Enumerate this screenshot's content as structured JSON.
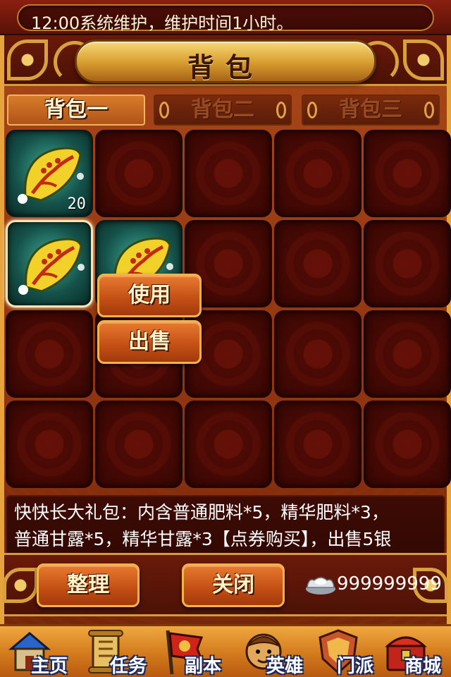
{
  "notice": {
    "text": "12:00系统维护，维护时间1小时。"
  },
  "panel": {
    "title": "背包"
  },
  "tabs": [
    {
      "label": "背包一",
      "active": true
    },
    {
      "label": "背包二",
      "active": false
    },
    {
      "label": "背包三",
      "active": false
    }
  ],
  "grid": {
    "rows": 4,
    "cols": 5,
    "items": [
      {
        "slot": 0,
        "icon": "gift-leaf-icon",
        "count": "20"
      },
      {
        "slot": 5,
        "icon": "gift-leaf-icon",
        "selected": true
      },
      {
        "slot": 6,
        "icon": "gift-leaf-icon"
      }
    ]
  },
  "context_menu": {
    "use_label": "使用",
    "sell_label": "出售"
  },
  "description": {
    "line1": "快快长大礼包：内含普通肥料*5，精华肥料*3，",
    "line2": "普通甘露*5，精华甘露*3【点券购买】，出售5银"
  },
  "actions": {
    "sort_label": "整理",
    "close_label": "关闭"
  },
  "currency": {
    "icon": "silver-ingot-icon",
    "amount": "999999999"
  },
  "nav": [
    {
      "label": "主页",
      "icon": "home-icon"
    },
    {
      "label": "任务",
      "icon": "scroll-icon"
    },
    {
      "label": "副本",
      "icon": "flag-icon"
    },
    {
      "label": "英雄",
      "icon": "hero-icon"
    },
    {
      "label": "门派",
      "icon": "shield-icon"
    },
    {
      "label": "商城",
      "icon": "treasure-chest-icon"
    }
  ],
  "colors": {
    "accent_gold": "#d9a13c",
    "button_orange": "#c24e14",
    "slot_dark_red": "#3c0703"
  }
}
